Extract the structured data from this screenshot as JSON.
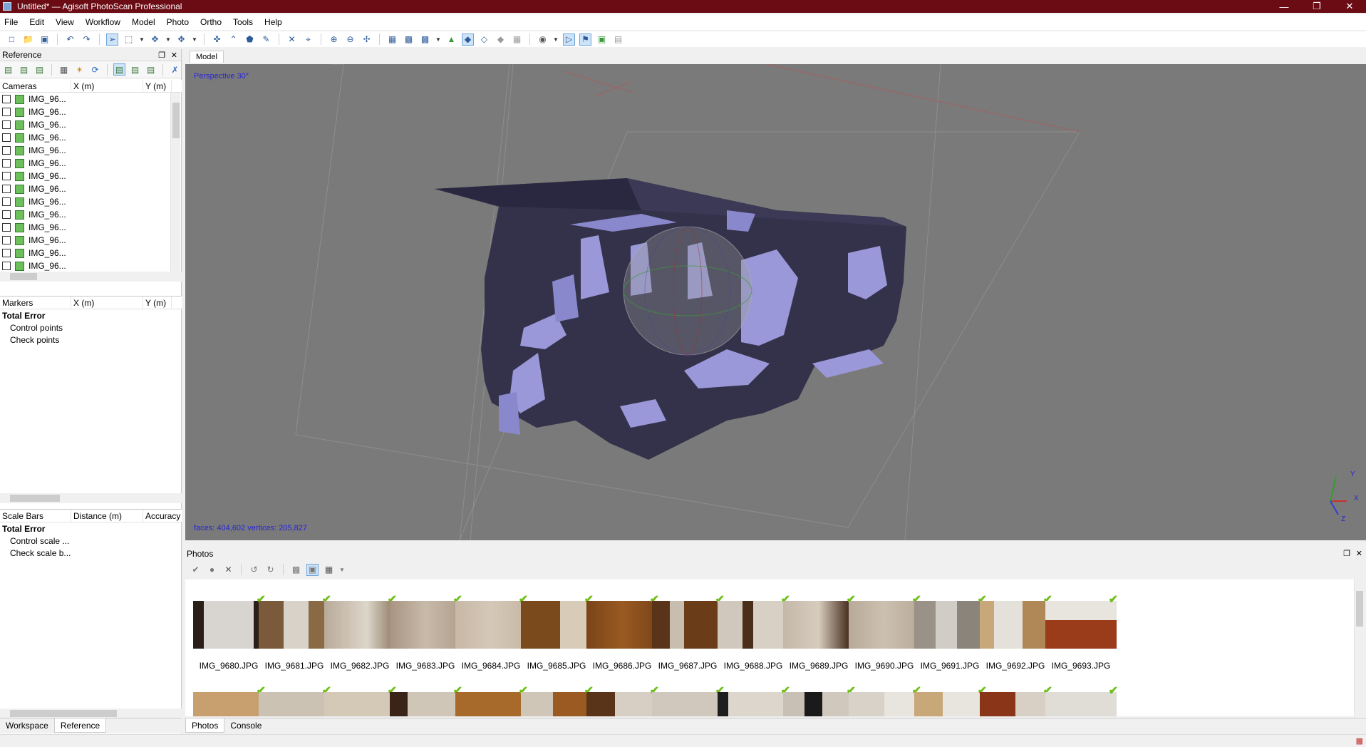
{
  "window": {
    "title": "Untitled* — Agisoft PhotoScan Professional"
  },
  "menu": [
    "File",
    "Edit",
    "View",
    "Workflow",
    "Model",
    "Photo",
    "Ortho",
    "Tools",
    "Help"
  ],
  "reference_panel": {
    "title": "Reference",
    "cameras": {
      "columns": [
        "Cameras",
        "X (m)",
        "Y (m)"
      ],
      "rows": [
        "IMG_96...",
        "IMG_96...",
        "IMG_96...",
        "IMG_96...",
        "IMG_96...",
        "IMG_96...",
        "IMG_96...",
        "IMG_96...",
        "IMG_96...",
        "IMG_96...",
        "IMG_96...",
        "IMG_96...",
        "IMG_96...",
        "IMG_96..."
      ]
    },
    "markers": {
      "columns": [
        "Markers",
        "X (m)",
        "Y (m)"
      ],
      "total_error": "Total Error",
      "items": [
        "Control points",
        "Check points"
      ]
    },
    "scale_bars": {
      "columns": [
        "Scale Bars",
        "Distance (m)",
        "Accuracy"
      ],
      "total_error": "Total Error",
      "items": [
        "Control scale ...",
        "Check scale b..."
      ]
    },
    "tabs": [
      "Workspace",
      "Reference"
    ]
  },
  "model": {
    "tab": "Model",
    "projection": "Perspective 30°",
    "stats": "faces: 404,602 vertices: 205,827",
    "axes": {
      "x": "X",
      "y": "Y",
      "z": "Z"
    },
    "colors": {
      "background": "#7a7a7a",
      "mesh": "#34324a",
      "mesh_light": "#9a98d8",
      "label": "#2626d8"
    }
  },
  "photos_panel": {
    "title": "Photos",
    "row1": [
      "IMG_9680.JPG",
      "IMG_9681.JPG",
      "IMG_9682.JPG",
      "IMG_9683.JPG",
      "IMG_9684.JPG",
      "IMG_9685.JPG",
      "IMG_9686.JPG",
      "IMG_9687.JPG",
      "IMG_9688.JPG",
      "IMG_9689.JPG",
      "IMG_9690.JPG",
      "IMG_9691.JPG",
      "IMG_9692.JPG",
      "IMG_9693.JPG"
    ],
    "tabs": [
      "Photos",
      "Console"
    ]
  }
}
